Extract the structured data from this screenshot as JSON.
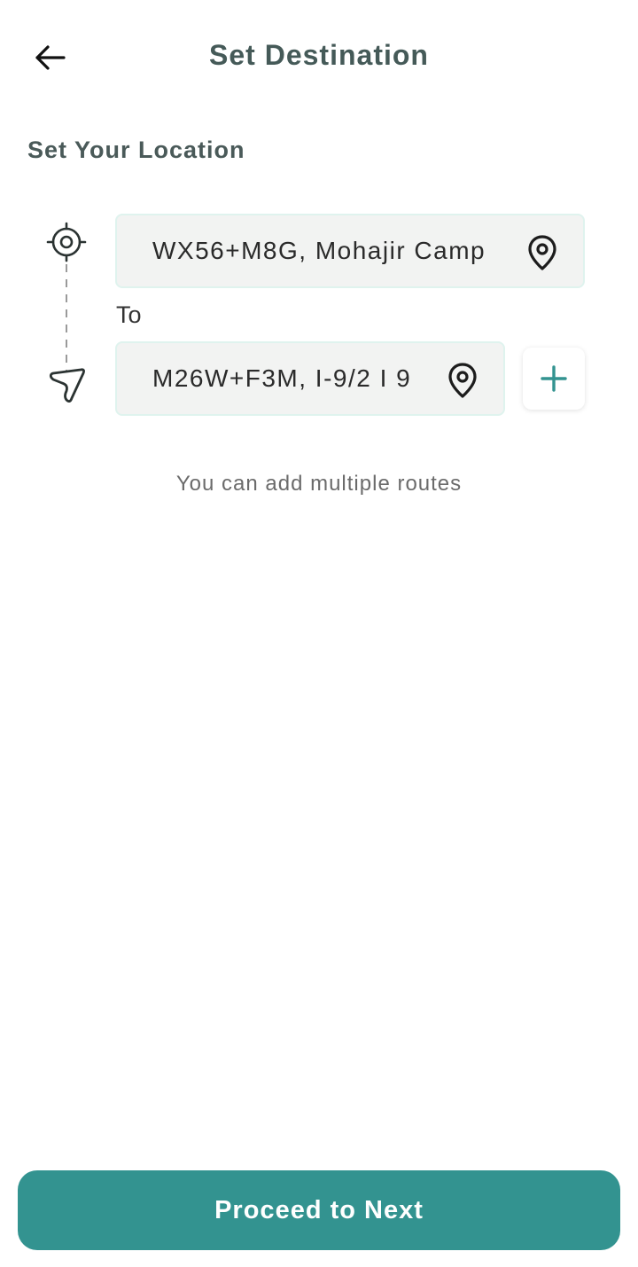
{
  "header": {
    "title": "Set Destination",
    "back_icon": "arrow-left-icon"
  },
  "location": {
    "section_title": "Set Your Location",
    "from": {
      "value": "WX56+M8G, Mohajir Camp",
      "icon": "map-pin-icon"
    },
    "connector_label": "To",
    "to": {
      "value": "M26W+F3M, I-9/2 I 9",
      "icon": "map-pin-icon"
    },
    "add_route_icon": "plus-icon",
    "hint": "You can add multiple routes"
  },
  "footer": {
    "proceed_label": "Proceed to Next"
  },
  "colors": {
    "accent": "#339390",
    "title": "#455a58",
    "field_bg": "#f2f3f2",
    "field_border": "#dff3ee"
  }
}
